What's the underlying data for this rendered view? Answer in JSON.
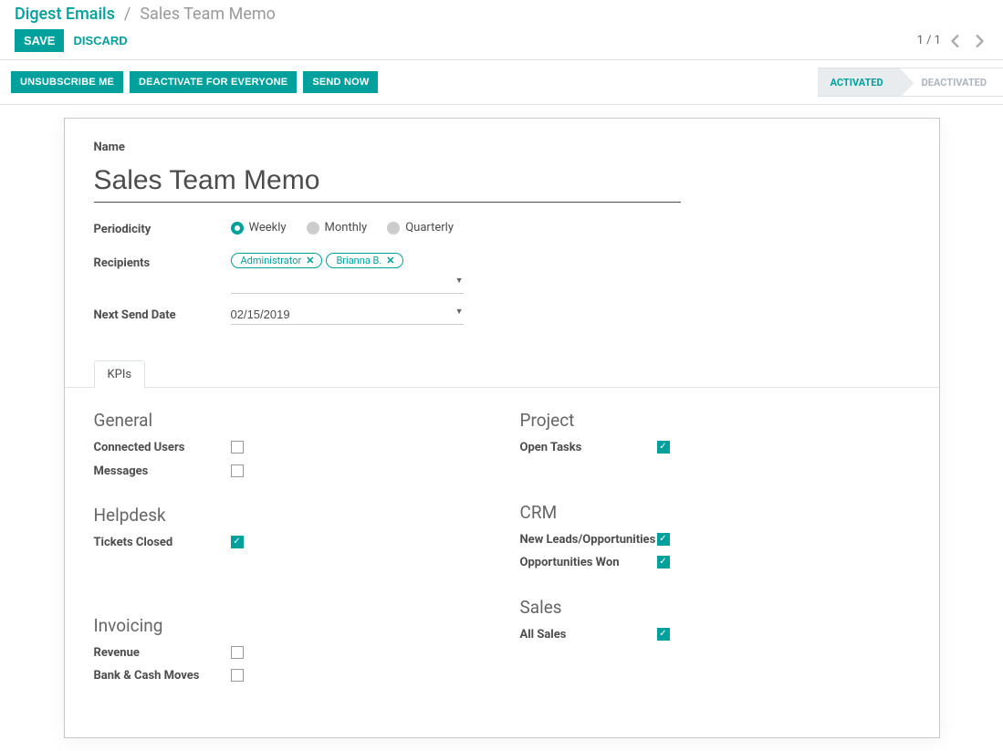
{
  "breadcrumb": {
    "parent": "Digest Emails",
    "current": "Sales Team Memo"
  },
  "controls": {
    "save": "SAVE",
    "discard": "DISCARD",
    "pager": "1 / 1"
  },
  "statusbar": {
    "buttons": {
      "unsubscribe": "UNSUBSCRIBE ME",
      "deactivate": "DEACTIVATE FOR EVERYONE",
      "send": "SEND NOW"
    },
    "stages": {
      "activated": "ACTIVATED",
      "deactivated": "DEACTIVATED"
    }
  },
  "form": {
    "name_label": "Name",
    "name_value": "Sales Team Memo",
    "periodicity_label": "Periodicity",
    "periodicity_options": {
      "weekly": "Weekly",
      "monthly": "Monthly",
      "quarterly": "Quarterly"
    },
    "recipients_label": "Recipients",
    "recipients": {
      "0": "Administrator",
      "1": "Brianna B."
    },
    "next_send_label": "Next Send Date",
    "next_send_value": "02/15/2019"
  },
  "tabs": {
    "kpis": "KPIs"
  },
  "kpi": {
    "general": {
      "title": "General",
      "connected": "Connected Users",
      "messages": "Messages"
    },
    "helpdesk": {
      "title": "Helpdesk",
      "tickets": "Tickets Closed"
    },
    "invoicing": {
      "title": "Invoicing",
      "revenue": "Revenue",
      "bank": "Bank & Cash Moves"
    },
    "project": {
      "title": "Project",
      "open": "Open Tasks"
    },
    "crm": {
      "title": "CRM",
      "leads": "New Leads/Opportunities",
      "won": "Opportunities Won"
    },
    "sales": {
      "title": "Sales",
      "all": "All Sales"
    }
  }
}
